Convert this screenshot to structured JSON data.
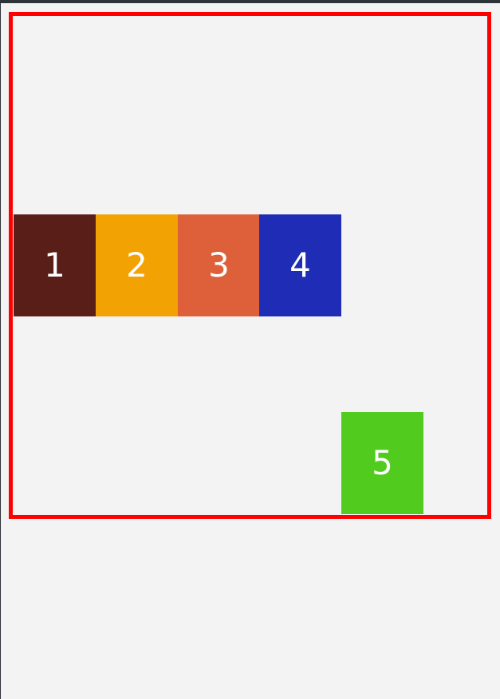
{
  "boxes": [
    {
      "label": "1",
      "color": "#581e17"
    },
    {
      "label": "2",
      "color": "#f2a202"
    },
    {
      "label": "3",
      "color": "#dd603a"
    },
    {
      "label": "4",
      "color": "#1f2cb6"
    },
    {
      "label": "5",
      "color": "#52cb1f"
    }
  ],
  "container": {
    "border_color": "#ff0000"
  },
  "page": {
    "background": "#f3f3f3"
  }
}
